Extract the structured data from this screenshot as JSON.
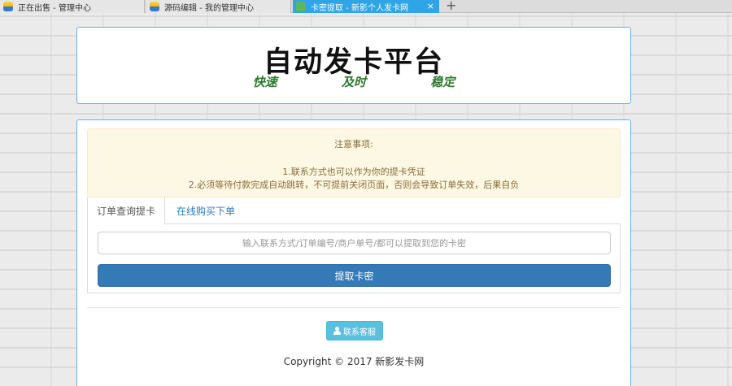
{
  "browser": {
    "tabs": [
      {
        "label": "正在出售 - 管理中心"
      },
      {
        "label": "源码编辑 - 我的管理中心"
      },
      {
        "label": "卡密提取 - 新影个人发卡网"
      }
    ],
    "close_symbol": "×",
    "new_tab_symbol": "+"
  },
  "header": {
    "title": "自动发卡平台",
    "slogan": [
      "快速",
      "及时",
      "稳定"
    ]
  },
  "notice": {
    "title": "注意事项:",
    "line1": "1.联系方式也可以作为你的提卡凭证",
    "line2": "2.必须等待付款完成自动跳转，不可提前关闭页面，否则会导致订单失效，后果自负"
  },
  "tabs": [
    {
      "label": "订单查询提卡",
      "active": true
    },
    {
      "label": "在线购买下单",
      "active": false
    }
  ],
  "form": {
    "placeholder": "输入联系方式/订单编号/商户单号/都可以提取到您的卡密",
    "value": "",
    "submit_label": "提取卡密"
  },
  "contact": {
    "label": "联系客服",
    "icon": "user-icon"
  },
  "footer": {
    "copyright": "Copyright © 2017 新影发卡网"
  },
  "colors": {
    "accent": "#337ab7",
    "info": "#5bc0de",
    "tab_active": "#2fa4e7",
    "slogan": "#2d7a2d"
  }
}
